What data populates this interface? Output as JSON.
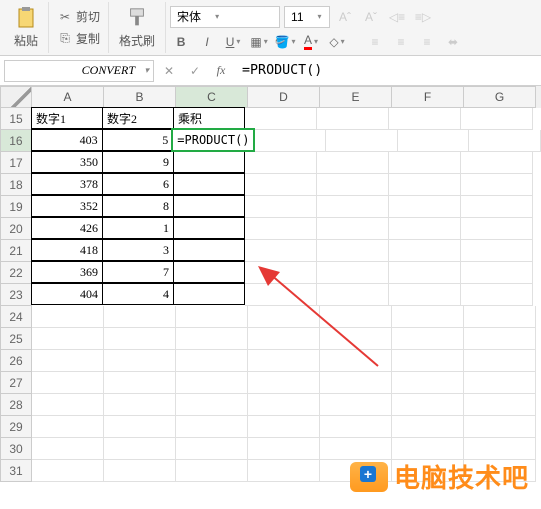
{
  "ribbon": {
    "paste_label": "粘贴",
    "cut_label": "剪切",
    "copy_label": "复制",
    "format_painter": "格式刷",
    "font_name": "宋体",
    "font_size": "11"
  },
  "formula_bar": {
    "name_box": "CONVERT",
    "formula": "=PRODUCT()"
  },
  "columns": [
    "A",
    "B",
    "C",
    "D",
    "E",
    "F",
    "G"
  ],
  "active_col": "C",
  "active_row": "16",
  "row_start": 15,
  "row_end": 31,
  "headers": {
    "a": "数字1",
    "b": "数字2",
    "c": "乘积"
  },
  "edit_cell": "=PRODUCT()",
  "rows": [
    {
      "a": "403",
      "b": "5"
    },
    {
      "a": "350",
      "b": "9"
    },
    {
      "a": "378",
      "b": "6"
    },
    {
      "a": "352",
      "b": "8"
    },
    {
      "a": "426",
      "b": "1"
    },
    {
      "a": "418",
      "b": "3"
    },
    {
      "a": "369",
      "b": "7"
    },
    {
      "a": "404",
      "b": "4"
    }
  ],
  "watermark": "电脑技术吧",
  "chart_data": {
    "type": "table",
    "title": "",
    "columns": [
      "数字1",
      "数字2",
      "乘积"
    ],
    "data": [
      [
        403,
        5,
        null
      ],
      [
        350,
        9,
        null
      ],
      [
        378,
        6,
        null
      ],
      [
        352,
        8,
        null
      ],
      [
        426,
        1,
        null
      ],
      [
        418,
        3,
        null
      ],
      [
        369,
        7,
        null
      ],
      [
        404,
        4,
        null
      ]
    ],
    "formula": "=PRODUCT()",
    "formula_cell": "C16"
  }
}
